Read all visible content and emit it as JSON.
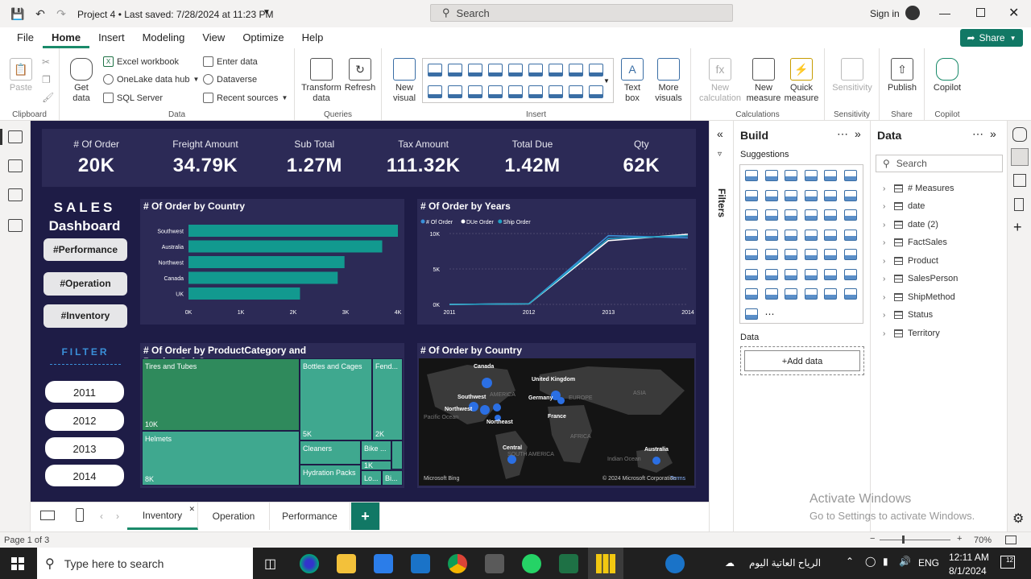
{
  "titlebar": {
    "title": "Project 4 • Last saved: 7/28/2024 at 11:23 PM",
    "search_placeholder": "Search",
    "signin": "Sign in"
  },
  "menu": {
    "items": [
      "File",
      "Home",
      "Insert",
      "Modeling",
      "View",
      "Optimize",
      "Help"
    ],
    "active": "Home",
    "share": "Share"
  },
  "ribbon": {
    "clipboard": {
      "paste": "Paste",
      "label": "Clipboard"
    },
    "data": {
      "get_data": "Get data",
      "excel": "Excel workbook",
      "onelake": "OneLake data hub",
      "sql": "SQL Server",
      "enter": "Enter data",
      "dataverse": "Dataverse",
      "recent": "Recent sources",
      "label": "Data"
    },
    "queries": {
      "transform": "Transform data",
      "refresh": "Refresh",
      "label": "Queries"
    },
    "insert": {
      "new_visual": "New visual",
      "text_box": "Text box",
      "more_visuals": "More visuals",
      "label": "Insert"
    },
    "calc": {
      "new_calc": "New calculation",
      "new_measure": "New measure",
      "quick_measure": "Quick measure",
      "label": "Calculations"
    },
    "sensitivity": {
      "btn": "Sensitivity",
      "label": "Sensitivity"
    },
    "share": {
      "publish": "Publish",
      "label": "Share"
    },
    "copilot": {
      "btn": "Copilot",
      "label": "Copilot"
    }
  },
  "kpis": [
    {
      "label": "# Of Order",
      "value": "20K"
    },
    {
      "label": "Freight Amount",
      "value": "34.79K"
    },
    {
      "label": "Sub Total",
      "value": "1.27M"
    },
    {
      "label": "Tax Amount",
      "value": "111.32K"
    },
    {
      "label": "Total Due",
      "value": "1.42M"
    },
    {
      "label": "Qty",
      "value": "62K"
    }
  ],
  "dashboard": {
    "title_1": "SALES",
    "title_2": "Dashboard",
    "nav": [
      "#Performance",
      "#Operation",
      "#Inventory"
    ],
    "filter_label": "FILTER",
    "years": [
      "2011",
      "2012",
      "2013",
      "2014"
    ]
  },
  "chart_data": [
    {
      "type": "bar",
      "title": "# Of Order by Country",
      "categories": [
        "Southwest",
        "Australia",
        "Northwest",
        "Canada",
        "UK"
      ],
      "values": [
        4000,
        3700,
        2980,
        2850,
        2130
      ],
      "xlim": [
        0,
        4000
      ],
      "ticks": [
        "0K",
        "1K",
        "2K",
        "3K",
        "4K"
      ],
      "color": "#12998f"
    },
    {
      "type": "line",
      "title": "# Of Order by Years",
      "x": [
        "2011",
        "2012",
        "2013",
        "2014"
      ],
      "ylim": [
        0,
        10000
      ],
      "yticks": [
        "0K",
        "5K",
        "10K"
      ],
      "series": [
        {
          "name": "# Of Order",
          "values": [
            0,
            90,
            9700,
            9400
          ],
          "color": "#3a8fd8"
        },
        {
          "name": "DUe Order",
          "values": [
            0,
            80,
            9000,
            9900
          ],
          "color": "#ffffff"
        },
        {
          "name": "Ship Order",
          "values": [
            0,
            85,
            9300,
            9700
          ],
          "color": "#1fa0c4"
        }
      ]
    }
  ],
  "treemap": {
    "title": "# Of Order by ProductCategory and ProductSubCategory",
    "cells": [
      {
        "label": "Tires and Tubes",
        "value": "10K"
      },
      {
        "label": "Bottles and Cages",
        "value": "5K"
      },
      {
        "label": "Fend...",
        "value": "2K"
      },
      {
        "label": "Helmets",
        "value": "8K"
      },
      {
        "label": "Cleaners",
        "value": ""
      },
      {
        "label": "Bike ...",
        "value": ""
      },
      {
        "label": "1K",
        "value": ""
      },
      {
        "label": "Hydration Packs",
        "value": ""
      },
      {
        "label": "Lo...",
        "value": ""
      },
      {
        "label": "Bi...",
        "value": ""
      }
    ]
  },
  "map": {
    "title": "# Of Order by Country",
    "labels": [
      "Canada",
      "United Kingdom",
      "Southwest",
      "Germany",
      "Northwest",
      "France",
      "Northeast",
      "Central",
      "Australia"
    ],
    "continents": [
      "AMERICA",
      "EUROPE",
      "ASIA",
      "AFRICA",
      "SOUTH AMERICA",
      "Pacific Ocean",
      "Indian Ocean"
    ],
    "credit_left": "Microsoft Bing",
    "credit_right": "© 2024 Microsoft Corporation",
    "terms": "Terms"
  },
  "filters_label": "Filters",
  "build": {
    "title": "Build",
    "suggestions": "Suggestions",
    "data_label": "Data",
    "add_data": "+Add data"
  },
  "datapane": {
    "title": "Data",
    "search_placeholder": "Search",
    "items": [
      "# Measures",
      "date",
      "date (2)",
      "FactSales",
      "Product",
      "SalesPerson",
      "ShipMethod",
      "Status",
      "Territory"
    ]
  },
  "tabs": {
    "pages": [
      "Inventory",
      "Operation",
      "Performance"
    ],
    "active": "Inventory",
    "add": "+"
  },
  "status": {
    "page": "Page 1 of 3",
    "zoom": "70%"
  },
  "activate": {
    "line1": "Activate Windows",
    "line2": "Go to Settings to activate Windows."
  },
  "taskbar": {
    "search": "Type here to search",
    "weather": "الرياح العاتية اليوم",
    "lang": "ENG",
    "time": "12:11 AM",
    "date": "8/1/2024",
    "badge": "12"
  }
}
